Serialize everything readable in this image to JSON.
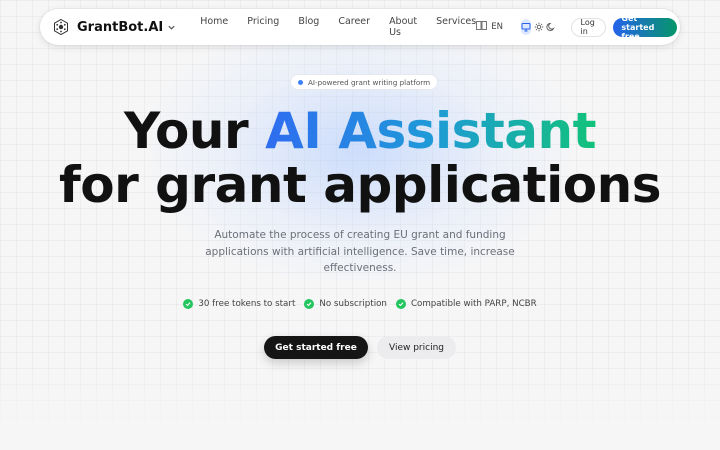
{
  "nav": {
    "brand": "GrantBot.AI",
    "links": [
      "Home",
      "Pricing",
      "Blog",
      "Career",
      "About Us",
      "Services"
    ],
    "language": "EN",
    "login_label": "Log in",
    "cta_label": "Get started free"
  },
  "hero": {
    "badge": "AI-powered grant writing platform",
    "headline_line1_a": "Your ",
    "headline_line1_b": "AI Assistant",
    "headline_line2": "for grant applications",
    "subtitle": "Automate the process of creating EU grant and funding applications with artificial intelligence. Save time, increase effectiveness.",
    "features": [
      "30 free tokens to start",
      "No subscription",
      "Compatible with PARP, NCBR"
    ],
    "primary_button": "Get started free",
    "secondary_button": "View pricing"
  },
  "colors": {
    "accent_blue": "#2563eb",
    "accent_green": "#059669",
    "check_green": "#22c55e",
    "dark_button": "#151515"
  },
  "icons": {
    "logo": "hexagon-logo-icon",
    "brand_menu": "chevron-down-icon",
    "language": "translate-icon",
    "theme_system": "monitor-icon",
    "theme_light": "sun-icon",
    "theme_dark": "moon-icon",
    "feature_check": "check-circle-icon"
  }
}
